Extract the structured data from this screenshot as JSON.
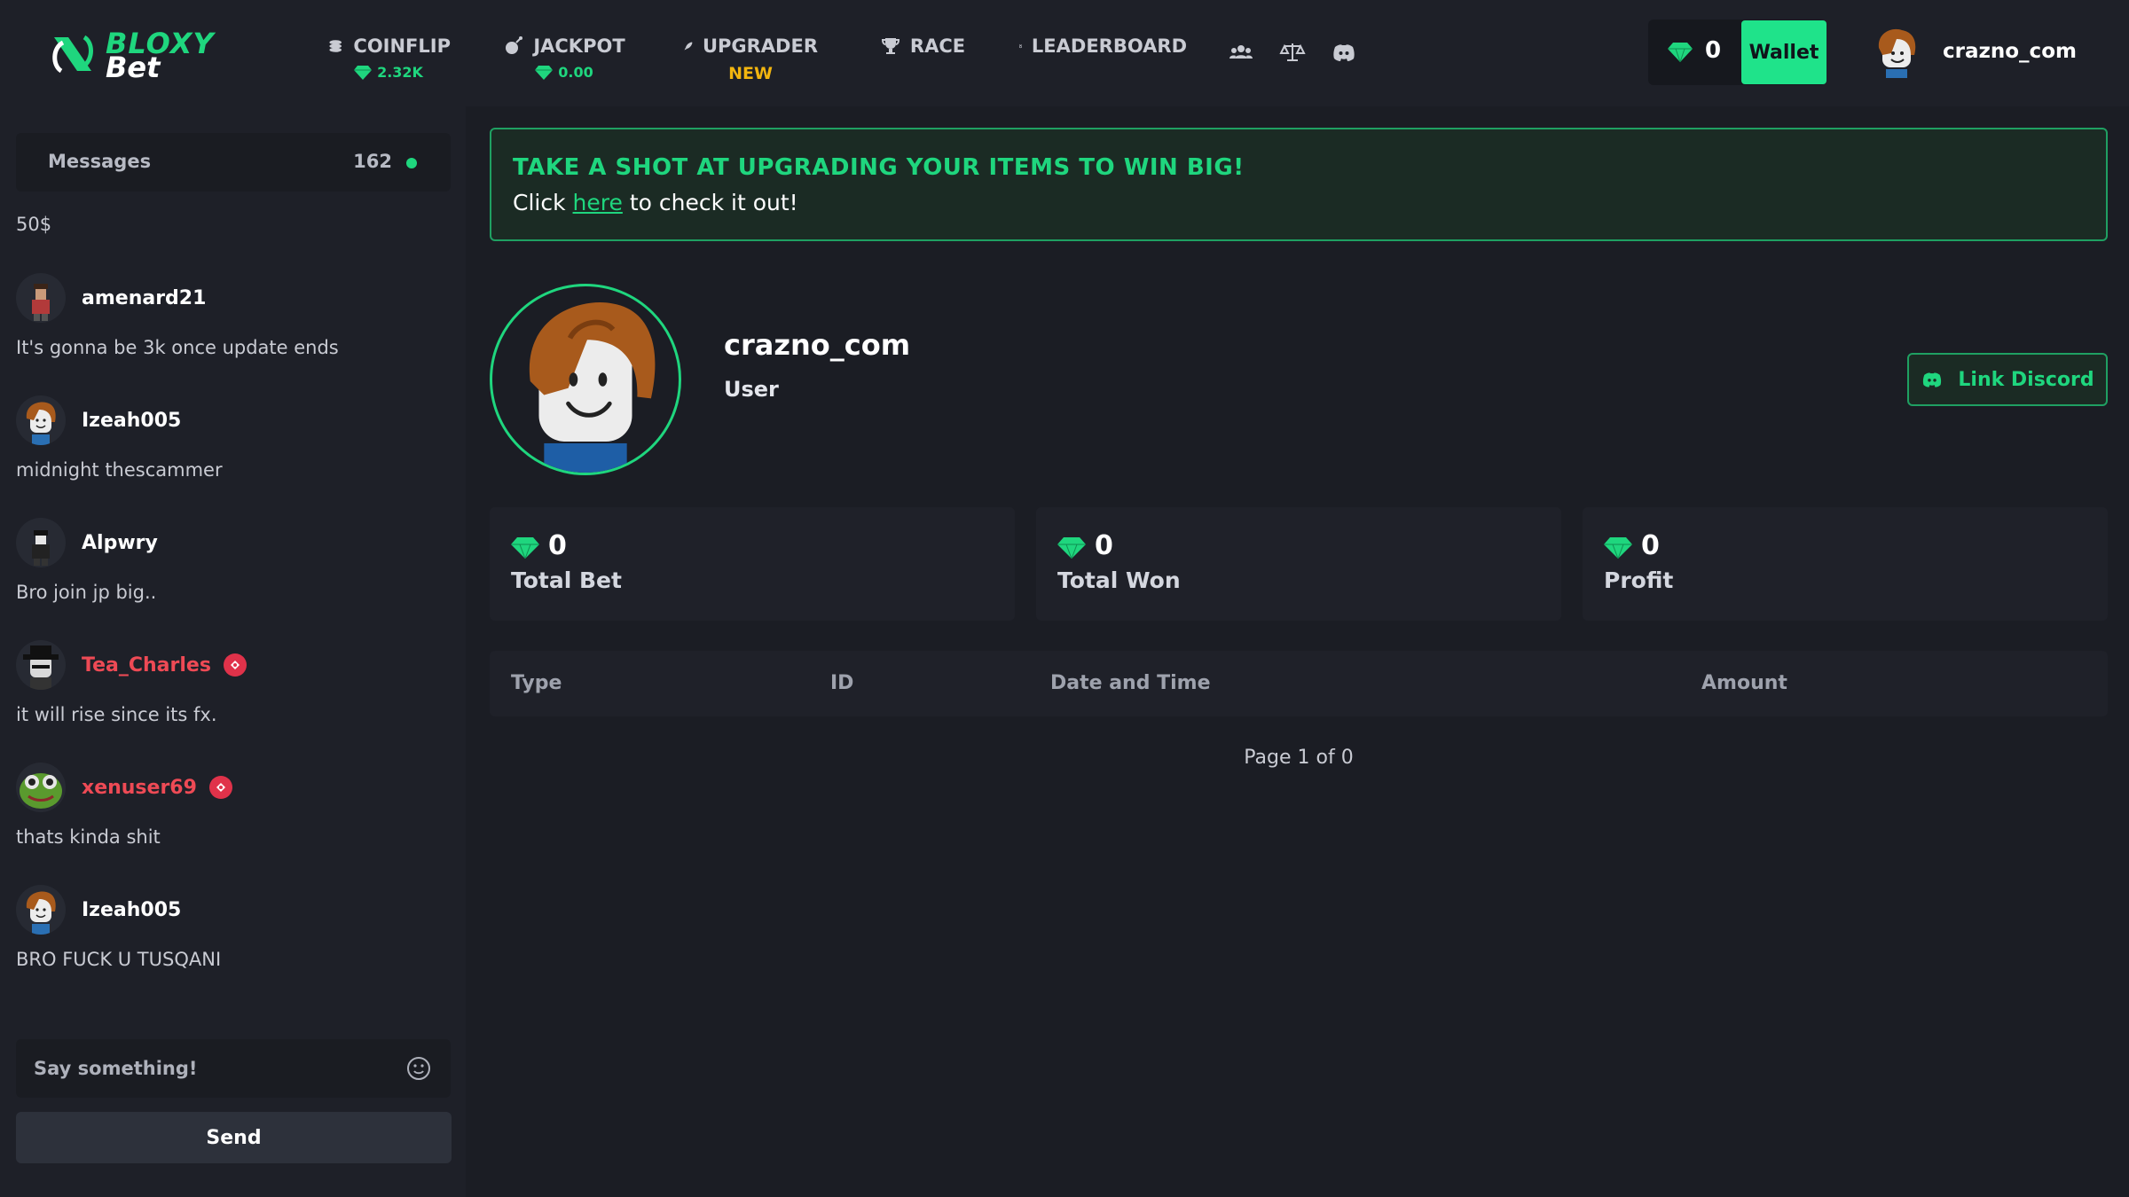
{
  "brand": {
    "line1": "BLOXY",
    "line2": "Bet"
  },
  "nav": {
    "coinflip": {
      "label": "COINFLIP",
      "sub": "2.32K"
    },
    "jackpot": {
      "label": "JACKPOT",
      "sub": "0.00"
    },
    "upgrader": {
      "label": "UPGRADER",
      "sub": "NEW"
    },
    "race": {
      "label": "RACE"
    },
    "leaderboard": {
      "label": "LEADERBOARD"
    }
  },
  "wallet": {
    "balance": "0",
    "button": "Wallet"
  },
  "user": {
    "name": "crazno_com"
  },
  "chat": {
    "title": "Messages",
    "count": "162",
    "first_line": "50$",
    "messages": [
      {
        "user": "amenard21",
        "text": "It's gonna be 3k once update ends",
        "highlight": false
      },
      {
        "user": "Izeah005",
        "text": "midnight thescammer",
        "highlight": false
      },
      {
        "user": "Alpwry",
        "text": "Bro join jp big..",
        "highlight": false
      },
      {
        "user": "Tea_Charles",
        "text": "it will rise since its fx.",
        "highlight": true
      },
      {
        "user": "xenuser69",
        "text": "thats kinda shit",
        "highlight": true
      },
      {
        "user": "Izeah005",
        "text": "BRO FUCK U TUSQANI",
        "highlight": false
      }
    ],
    "input_placeholder": "Say something!",
    "send": "Send"
  },
  "banner": {
    "headline": "TAKE A SHOT AT UPGRADING YOUR ITEMS TO WIN BIG!",
    "pre": "Click",
    "link": "here",
    "post": "to check it out!"
  },
  "profile": {
    "name": "crazno_com",
    "role": "User",
    "discord_button": "Link Discord"
  },
  "stats": [
    {
      "value": "0",
      "label": "Total Bet"
    },
    {
      "value": "0",
      "label": "Total Won"
    },
    {
      "value": "0",
      "label": "Profit"
    }
  ],
  "table": {
    "columns": [
      "Type",
      "ID",
      "Date and Time",
      "Amount"
    ],
    "pager": "Page 1 of 0"
  },
  "colors": {
    "accent": "#1fd67e",
    "new": "#f2b50f",
    "highlight_user": "#ee4a55",
    "background": "#1b1d24"
  }
}
